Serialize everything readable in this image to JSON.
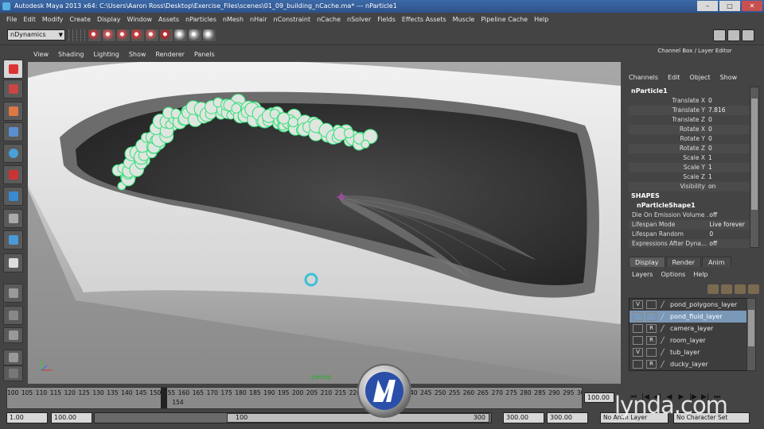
{
  "window": {
    "title": "Autodesk Maya 2013 x64: C:\\Users\\Aaron Ross\\Desktop\\Exercise_Files\\scenes\\01_09_building_nCache.ma*  ---  nParticle1",
    "min_label": "–",
    "max_label": "□",
    "close_label": "✕"
  },
  "menubar": [
    "File",
    "Edit",
    "Modify",
    "Create",
    "Display",
    "Window",
    "Assets",
    "nParticles",
    "nMesh",
    "nHair",
    "nConstraint",
    "nCache",
    "nSolver",
    "Fields",
    "Effects Assets",
    "Muscle",
    "Pipeline Cache",
    "Help"
  ],
  "statusline": {
    "menu_set": "nDynamics",
    "icons": [
      "create-nparticles-icon",
      "fill-object-icon",
      "goal-icon",
      "emitter-icon",
      "surface-emitter-icon",
      "magnet-icon",
      "create-ncache-icon",
      "append-cache-icon",
      "replace-cache-icon"
    ],
    "right_icons": [
      "channel-box-toggle-icon",
      "attribute-editor-icon",
      "tool-settings-icon"
    ]
  },
  "toolbox": [
    "select-tool-icon",
    "lasso-tool-icon",
    "paint-select-icon",
    "move-tool-icon",
    "rotate-tool-icon",
    "scale-tool-icon",
    "universal-manipulator-icon",
    "soft-mod-icon",
    "show-manipulator-icon",
    "last-tool-icon",
    "single-perspective-layout-icon",
    "four-view-layout-icon",
    "persp-outliner-layout-icon",
    "persp-graph-layout-icon",
    "outliner-icon"
  ],
  "panel_menu": [
    "View",
    "Shading",
    "Lighting",
    "Show",
    "Renderer",
    "Panels"
  ],
  "viewport": {
    "camera": "persp",
    "accent_particle": "#33e07a"
  },
  "channel_box": {
    "title": "Channel Box / Layer Editor",
    "menu": [
      "Channels",
      "Edit",
      "Object",
      "Show"
    ],
    "node": "nParticle1",
    "attributes": [
      {
        "label": "Translate X",
        "value": "0"
      },
      {
        "label": "Translate Y",
        "value": "7.816"
      },
      {
        "label": "Translate Z",
        "value": "0"
      },
      {
        "label": "Rotate X",
        "value": "0"
      },
      {
        "label": "Rotate Y",
        "value": "0"
      },
      {
        "label": "Rotate Z",
        "value": "0"
      },
      {
        "label": "Scale X",
        "value": "1"
      },
      {
        "label": "Scale Y",
        "value": "1"
      },
      {
        "label": "Scale Z",
        "value": "1"
      },
      {
        "label": "Visibility",
        "value": "on"
      }
    ],
    "shapes_header": "SHAPES",
    "shape_name": "nParticleShape1",
    "shape_attributes": [
      {
        "label": "Die On Emission Volume ...",
        "value": "off"
      },
      {
        "label": "Lifespan Mode",
        "value": "Live forever"
      },
      {
        "label": "Lifespan Random",
        "value": "0"
      },
      {
        "label": "Expressions After Dyna...",
        "value": "off"
      }
    ]
  },
  "layer_editor": {
    "tabs": [
      "Display",
      "Render",
      "Anim"
    ],
    "active_tab": "Display",
    "menu": [
      "Layers",
      "Options",
      "Help"
    ],
    "layers": [
      {
        "v": "V",
        "r": "",
        "name": "pond_polygons_layer",
        "selected": false
      },
      {
        "v": "",
        "r": "",
        "name": "pond_fluid_layer",
        "selected": true
      },
      {
        "v": "",
        "r": "R",
        "name": "camera_layer",
        "selected": false
      },
      {
        "v": "",
        "r": "R",
        "name": "room_layer",
        "selected": false
      },
      {
        "v": "V",
        "r": "",
        "name": "tub_layer",
        "selected": false
      },
      {
        "v": "",
        "r": "R",
        "name": "ducky_layer",
        "selected": false
      }
    ]
  },
  "time_slider": {
    "ticks": [
      "100",
      "105",
      "110",
      "115",
      "120",
      "125",
      "130",
      "135",
      "140",
      "145",
      "150",
      "155",
      "160",
      "165",
      "170",
      "175",
      "180",
      "185",
      "190",
      "195",
      "200",
      "205",
      "210",
      "215",
      "220",
      "225",
      "230",
      "235",
      "240",
      "245",
      "250",
      "255",
      "260",
      "265",
      "270",
      "275",
      "280",
      "285",
      "290",
      "295",
      "300"
    ],
    "current_frame": "154",
    "end_frame": "100.00"
  },
  "playback": [
    "⏮",
    "|◀",
    "◀|",
    "◀",
    "▶",
    "|▶",
    "▶|",
    "⏭"
  ],
  "range": {
    "start": "1.00",
    "min": "100.00",
    "thumb_lo": "100",
    "thumb_hi": "300",
    "max": "300.00",
    "end": "300.00",
    "anim_layer": "No Anim Layer",
    "character_set": "No Character Set"
  },
  "watermark": "lynda.com"
}
